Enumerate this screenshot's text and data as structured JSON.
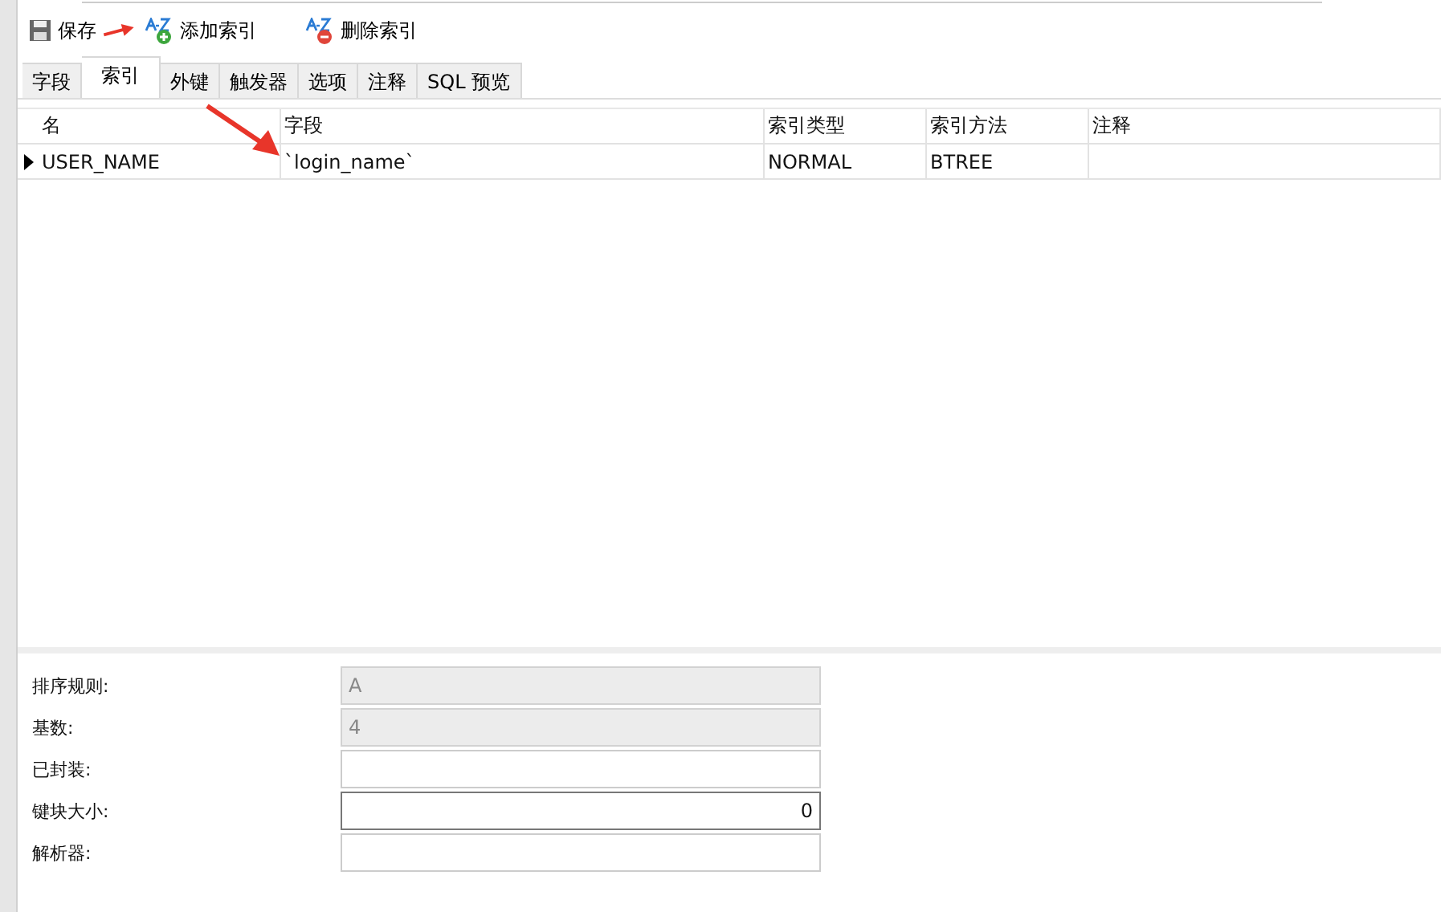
{
  "toolbar": [
    {
      "kind": "save",
      "label": "保存"
    },
    {
      "kind": "add",
      "label": "添加索引"
    },
    {
      "kind": "delete",
      "label": "删除索引"
    }
  ],
  "tabs": [
    {
      "label": "字段",
      "selected": false
    },
    {
      "label": "索引",
      "selected": true
    },
    {
      "label": "外键",
      "selected": false
    },
    {
      "label": "触发器",
      "selected": false
    },
    {
      "label": "选项",
      "selected": false
    },
    {
      "label": "注释",
      "selected": false
    },
    {
      "label": "SQL 预览",
      "selected": false
    }
  ],
  "table": {
    "columns": [
      "名",
      "字段",
      "索引类型",
      "索引方法",
      "注释"
    ],
    "rows": [
      {
        "current": true,
        "cells": [
          "USER_NAME",
          "`login_name`",
          "NORMAL",
          "BTREE",
          ""
        ]
      }
    ]
  },
  "properties": [
    {
      "label": "排序规则:",
      "value": "A",
      "disabled": true,
      "kind": "text",
      "focused": false
    },
    {
      "label": "基数:",
      "value": "4",
      "disabled": true,
      "kind": "text",
      "focused": false
    },
    {
      "label": "已封装:",
      "disabled": false,
      "kind": "text",
      "focused": false
    },
    {
      "label": "键块大小:",
      "value": "0",
      "disabled": false,
      "kind": "number",
      "focused": true
    },
    {
      "label": "解析器:",
      "disabled": false,
      "kind": "text",
      "focused": false
    }
  ]
}
